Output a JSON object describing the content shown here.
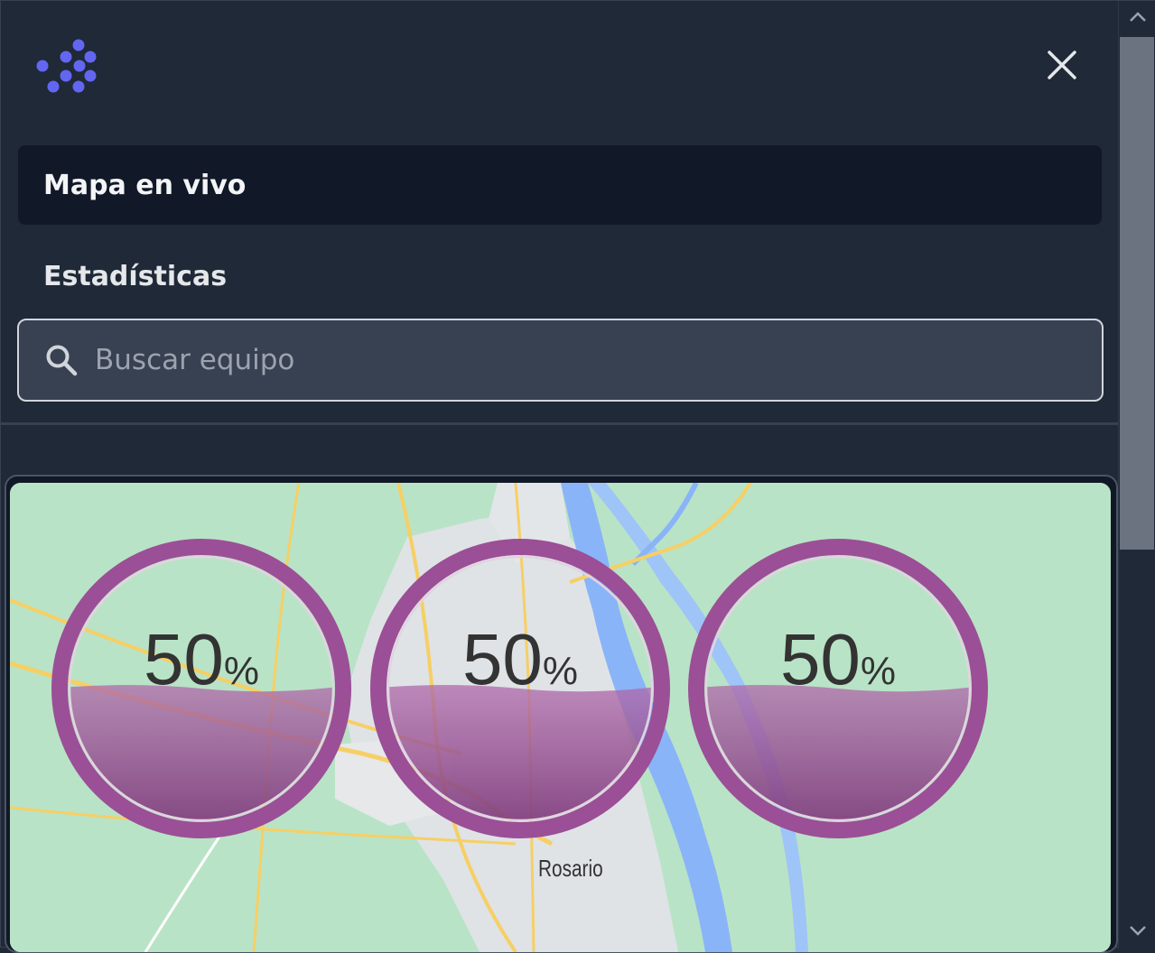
{
  "app": {
    "logo_icon": "dots-chevron-logo-icon",
    "close_icon": "close-icon",
    "accent_color": "#6366f1"
  },
  "nav": {
    "items": [
      {
        "label": "Mapa en vivo",
        "active": true
      },
      {
        "label": "Estadísticas",
        "active": false
      }
    ]
  },
  "search": {
    "icon": "search-icon",
    "placeholder": "Buscar equipo",
    "value": ""
  },
  "map": {
    "city_label": "Rosario",
    "background_color": "#b9e3c6",
    "gauges": [
      {
        "value": "50",
        "unit": "%",
        "level": 0.5,
        "color": "#9b4f96"
      },
      {
        "value": "50",
        "unit": "%",
        "level": 0.5,
        "color": "#9b4f96"
      },
      {
        "value": "50",
        "unit": "%",
        "level": 0.5,
        "color": "#9b4f96"
      }
    ]
  },
  "scrollbar": {
    "up_icon": "chevron-up-icon",
    "down_icon": "chevron-down-icon"
  }
}
